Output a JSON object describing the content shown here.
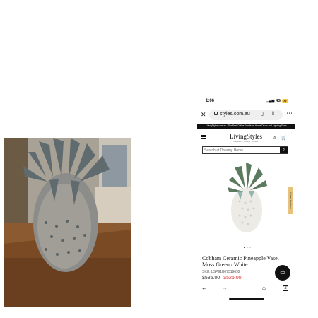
{
  "status": {
    "time": "1:06",
    "signal": "4G",
    "battery": "77"
  },
  "browser": {
    "url": "styles.com.au",
    "close_icon": "close-icon",
    "bookmark_icon": "bookmark-icon",
    "share_icon": "share-icon",
    "more_icon": "more-icon"
  },
  "banner": {
    "text": "LivingStyles.com.au · The Best Online Furniture, Home Decor and Lighting Store"
  },
  "header": {
    "logo": "LivingStyles",
    "tagline": "CREATE YOUR HOME"
  },
  "search": {
    "placeholder": "Search at Dreamy Home"
  },
  "feedback_tab": {
    "label": "Submit feedback"
  },
  "product": {
    "title": "Cobham Ceramic Pineapple Vase, Moss Green / White",
    "sku": "SKU: LSP91B07519692",
    "old_price": "$585.00",
    "new_price": "$525.00"
  },
  "colors": {
    "accent_red": "#d33333",
    "feedback_tab": "#e8c27a"
  }
}
